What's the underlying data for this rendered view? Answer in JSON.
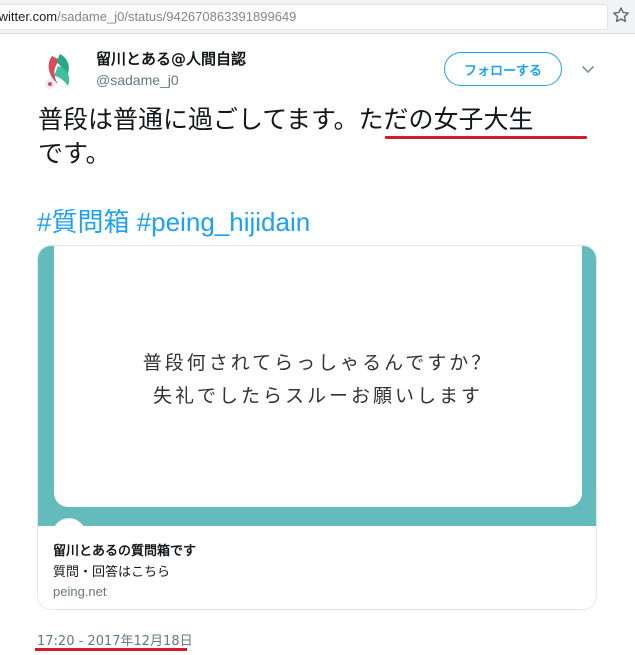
{
  "browser": {
    "url_host": "twitter.com",
    "url_path": "/sadame_j0/status/942670863391899649",
    "star_icon": "star-outline-icon"
  },
  "tweet": {
    "display_name": "留川とある@人間自認",
    "handle": "@sadame_j0",
    "follow_label": "フォローする",
    "menu_icon": "chevron-down-icon",
    "text_line1_plain": "普段は普通に過ごしてます。",
    "text_line1_highlight": "ただの女子大生",
    "text_line2": "です。",
    "hashtags": [
      "#質問箱",
      "#peing_hijidain"
    ],
    "timestamp": "17:20 - 2017年12月18日",
    "colors": {
      "accent": "#1da1f2",
      "underline": "#d71a2a",
      "card_teal": "#64bbbb"
    }
  },
  "card": {
    "question_line1": "普段何されてらっしゃるんですか？",
    "question_line2": "失礼でしたらスルーお願いします",
    "title": "留川とあるの質問箱です",
    "description": "質問・回答はこちら",
    "domain": "peing.net"
  }
}
